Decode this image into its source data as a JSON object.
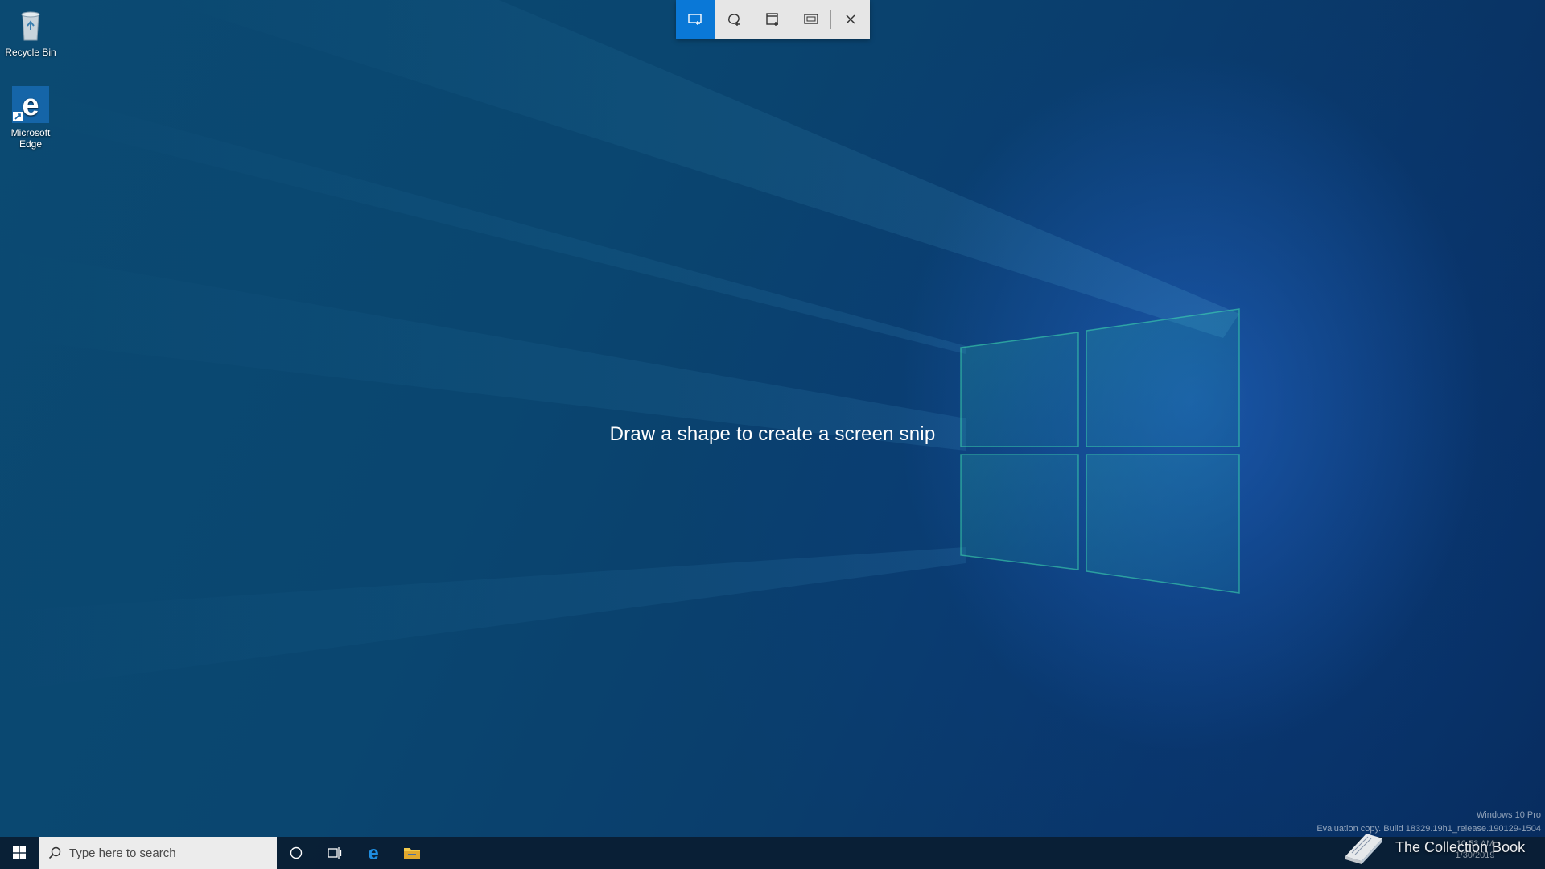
{
  "desktop": {
    "icons": [
      {
        "label": "Recycle Bin"
      },
      {
        "label": "Microsoft Edge"
      }
    ]
  },
  "snip_toolbar": {
    "modes": [
      "rectangular-snip",
      "freeform-snip",
      "window-snip",
      "fullscreen-snip"
    ],
    "active_mode": "rectangular-snip",
    "accent_color": "#0a78d7"
  },
  "prompt": {
    "text": "Draw a shape to create a screen snip"
  },
  "watermark": {
    "edition": "Windows 10 Pro",
    "build": "Evaluation copy. Build 18329.19h1_release.190129-1504"
  },
  "taskbar": {
    "search_placeholder": "Type here to search",
    "pinned_icons": [
      "cortana-icon",
      "task-view-icon",
      "edge-icon",
      "file-explorer-icon"
    ]
  },
  "overlay": {
    "brand": "The Collection Book"
  },
  "clock": {
    "time": "10:53 AM",
    "date": "1/30/2019"
  }
}
